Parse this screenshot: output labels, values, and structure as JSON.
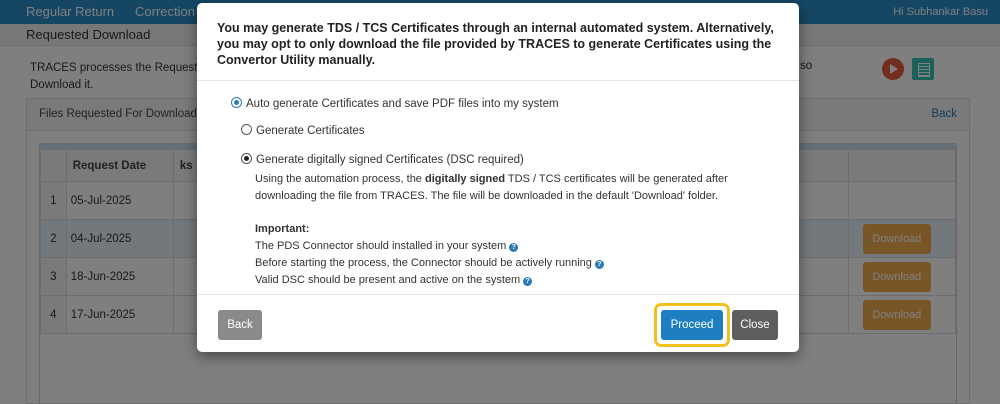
{
  "nav": {
    "items": [
      "Regular Return",
      "Correction"
    ],
    "user": "Hi Subhankar Basu"
  },
  "page": {
    "heading": "Requested Download",
    "info_line1": "TRACES processes the Request for",
    "info_line2": "Download it.",
    "info_right": "so"
  },
  "panel": {
    "title": "Files Requested For Download",
    "back_link": "Back"
  },
  "table": {
    "headers": [
      "Request Date",
      "ks"
    ],
    "rows": [
      {
        "num": "1",
        "date": "05-Jul-2025",
        "action": ""
      },
      {
        "num": "2",
        "date": "04-Jul-2025",
        "action": "Download"
      },
      {
        "num": "3",
        "date": "18-Jun-2025",
        "action": "Download"
      },
      {
        "num": "4",
        "date": "17-Jun-2025",
        "action": "Download"
      }
    ]
  },
  "modal": {
    "message": "You may generate TDS / TCS Certificates through an internal automated system. Alternatively, you may opt to only download the file provided by TRACES to generate Certificates using the Convertor Utility manually.",
    "option_auto": "Auto generate Certificates and save PDF files into my system",
    "option_generate": "Generate Certificates",
    "option_dsc": "Generate digitally signed Certificates (DSC required)",
    "desc_part1": "Using the automation process, the ",
    "desc_bold": "digitally signed",
    "desc_part2": " TDS / TCS certificates will be generated after downloading the file from TRACES. The file will be downloaded in the default 'Download' folder.",
    "important_heading": "Important:",
    "important_items": [
      "The PDS Connector should installed in your system",
      "Before starting the process, the Connector should be actively running",
      "Valid DSC should be present and active on the system"
    ],
    "back_button": "Back",
    "proceed_button": "Proceed",
    "close_button": "Close"
  },
  "colors": {
    "nav": "#2a8fc9",
    "proceed": "#1e7fc0",
    "download": "#f0ad4e",
    "highlight_ring": "#f4c020"
  },
  "icons": {
    "play": "play-circle-icon",
    "document": "document-icon",
    "help": "question-circle-icon"
  }
}
